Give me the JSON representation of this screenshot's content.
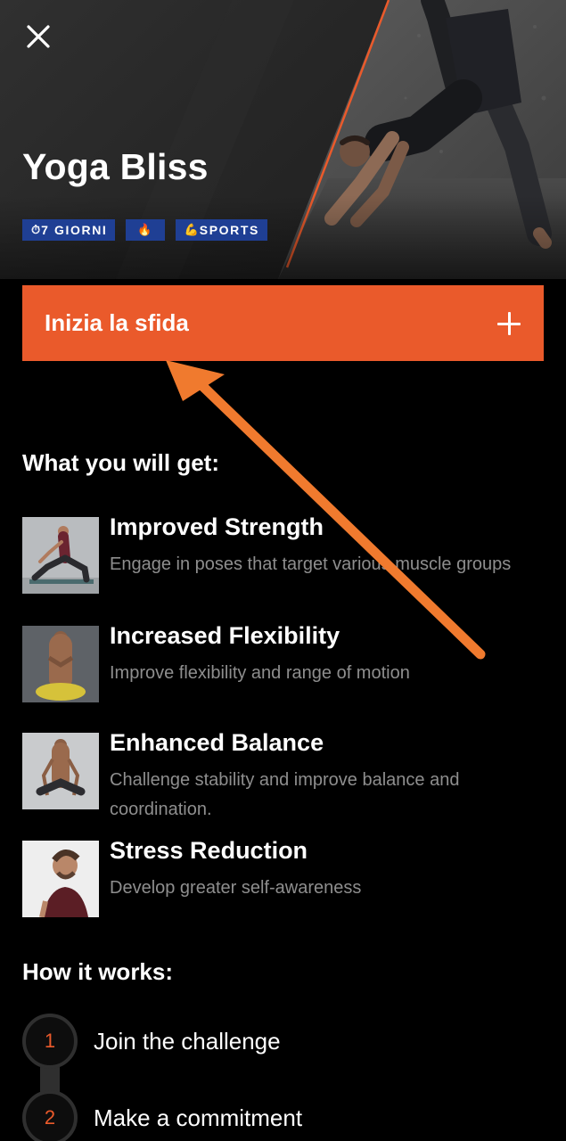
{
  "header": {
    "title": "Yoga Bliss",
    "close_icon": "close-icon",
    "tags": [
      {
        "emoji": "⏱",
        "label": "7 GIORNI",
        "icon": "stopwatch-icon"
      },
      {
        "emoji": "🔥",
        "label": "",
        "icon": "fire-icon"
      },
      {
        "emoji": "💪",
        "label": "SPORTS",
        "icon": "flexed-biceps-icon"
      }
    ]
  },
  "cta": {
    "label": "Inizia la sfida",
    "icon": "plus-icon",
    "color": "#ea5a2b"
  },
  "benefits": {
    "title": "What you will get:",
    "items": [
      {
        "title": "Improved Strength",
        "desc": "Engage in poses that target various muscle groups"
      },
      {
        "title": "Increased Flexibility",
        "desc": "Improve flexibility and range of motion"
      },
      {
        "title": "Enhanced Balance",
        "desc": "Challenge stability and improve balance and coordination."
      },
      {
        "title": "Stress Reduction",
        "desc": "Develop greater self-awareness"
      }
    ]
  },
  "how_it_works": {
    "title": "How it works:",
    "steps": [
      {
        "num": "1",
        "label": "Join the challenge"
      },
      {
        "num": "2",
        "label": "Make a commitment"
      }
    ]
  },
  "colors": {
    "accent": "#ea5a2b",
    "tag_bg": "#1f3f94",
    "background": "#000000",
    "muted_text": "#8e8e8e"
  }
}
